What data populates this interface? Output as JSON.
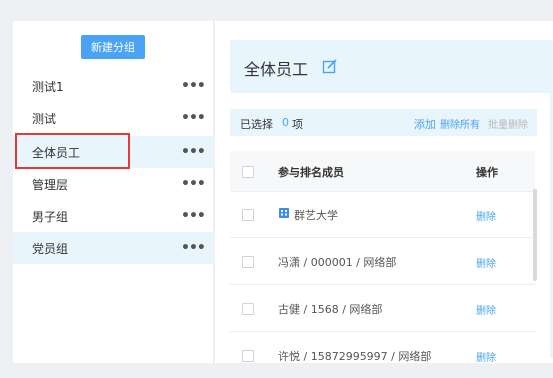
{
  "sidebar": {
    "new_group_label": "新建分组",
    "more_glyph": "•••",
    "groups": [
      {
        "label": "测试1"
      },
      {
        "label": "测试"
      },
      {
        "label": "全体员工"
      },
      {
        "label": "管理层"
      },
      {
        "label": "男子组"
      },
      {
        "label": "党员组"
      }
    ]
  },
  "main": {
    "title": "全体员工",
    "edit_icon": "edit-icon",
    "toolbar": {
      "selected_label": "已选择",
      "selected_count": "0",
      "selected_unit": "项",
      "add_label": "添加",
      "delete_all_label": "删除所有",
      "batch_delete_label": "批量删除"
    },
    "table": {
      "col_member": "参与排名成员",
      "col_action": "操作",
      "rows": [
        {
          "name": "群艺大学",
          "action": "删除"
        },
        {
          "name": "冯潇 / 000001 / 网络部",
          "action": "删除"
        },
        {
          "name": "古健 / 1568 / 网络部",
          "action": "删除"
        },
        {
          "name": "许悦 / 15872995997 / 网络部",
          "action": "删除"
        }
      ]
    }
  },
  "colors": {
    "accent": "#4aa3f5",
    "highlight": "#e9f5fd",
    "annotation_red": "#e53935"
  }
}
